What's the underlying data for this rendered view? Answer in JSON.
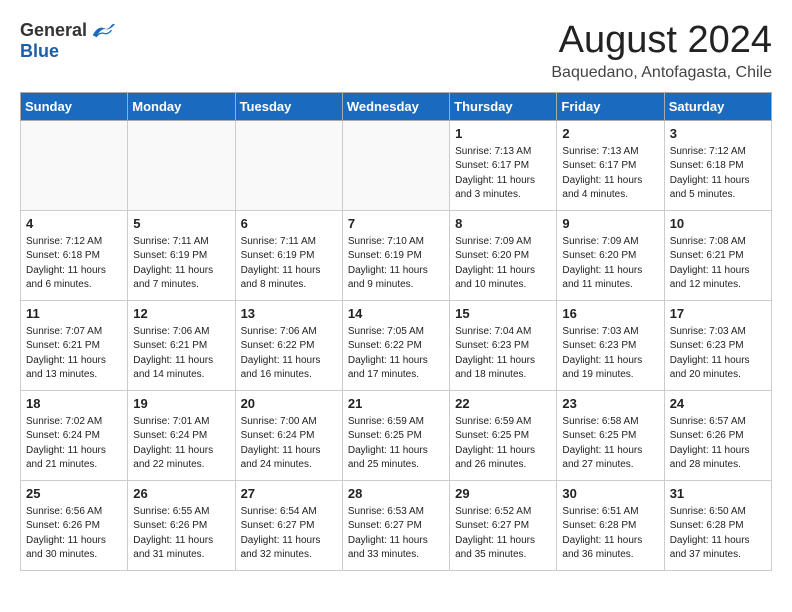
{
  "header": {
    "logo_general": "General",
    "logo_blue": "Blue",
    "month_year": "August 2024",
    "location": "Baquedano, Antofagasta, Chile"
  },
  "weekdays": [
    "Sunday",
    "Monday",
    "Tuesday",
    "Wednesday",
    "Thursday",
    "Friday",
    "Saturday"
  ],
  "weeks": [
    [
      {
        "day": "",
        "info": ""
      },
      {
        "day": "",
        "info": ""
      },
      {
        "day": "",
        "info": ""
      },
      {
        "day": "",
        "info": ""
      },
      {
        "day": "1",
        "info": "Sunrise: 7:13 AM\nSunset: 6:17 PM\nDaylight: 11 hours\nand 3 minutes."
      },
      {
        "day": "2",
        "info": "Sunrise: 7:13 AM\nSunset: 6:17 PM\nDaylight: 11 hours\nand 4 minutes."
      },
      {
        "day": "3",
        "info": "Sunrise: 7:12 AM\nSunset: 6:18 PM\nDaylight: 11 hours\nand 5 minutes."
      }
    ],
    [
      {
        "day": "4",
        "info": "Sunrise: 7:12 AM\nSunset: 6:18 PM\nDaylight: 11 hours\nand 6 minutes."
      },
      {
        "day": "5",
        "info": "Sunrise: 7:11 AM\nSunset: 6:19 PM\nDaylight: 11 hours\nand 7 minutes."
      },
      {
        "day": "6",
        "info": "Sunrise: 7:11 AM\nSunset: 6:19 PM\nDaylight: 11 hours\nand 8 minutes."
      },
      {
        "day": "7",
        "info": "Sunrise: 7:10 AM\nSunset: 6:19 PM\nDaylight: 11 hours\nand 9 minutes."
      },
      {
        "day": "8",
        "info": "Sunrise: 7:09 AM\nSunset: 6:20 PM\nDaylight: 11 hours\nand 10 minutes."
      },
      {
        "day": "9",
        "info": "Sunrise: 7:09 AM\nSunset: 6:20 PM\nDaylight: 11 hours\nand 11 minutes."
      },
      {
        "day": "10",
        "info": "Sunrise: 7:08 AM\nSunset: 6:21 PM\nDaylight: 11 hours\nand 12 minutes."
      }
    ],
    [
      {
        "day": "11",
        "info": "Sunrise: 7:07 AM\nSunset: 6:21 PM\nDaylight: 11 hours\nand 13 minutes."
      },
      {
        "day": "12",
        "info": "Sunrise: 7:06 AM\nSunset: 6:21 PM\nDaylight: 11 hours\nand 14 minutes."
      },
      {
        "day": "13",
        "info": "Sunrise: 7:06 AM\nSunset: 6:22 PM\nDaylight: 11 hours\nand 16 minutes."
      },
      {
        "day": "14",
        "info": "Sunrise: 7:05 AM\nSunset: 6:22 PM\nDaylight: 11 hours\nand 17 minutes."
      },
      {
        "day": "15",
        "info": "Sunrise: 7:04 AM\nSunset: 6:23 PM\nDaylight: 11 hours\nand 18 minutes."
      },
      {
        "day": "16",
        "info": "Sunrise: 7:03 AM\nSunset: 6:23 PM\nDaylight: 11 hours\nand 19 minutes."
      },
      {
        "day": "17",
        "info": "Sunrise: 7:03 AM\nSunset: 6:23 PM\nDaylight: 11 hours\nand 20 minutes."
      }
    ],
    [
      {
        "day": "18",
        "info": "Sunrise: 7:02 AM\nSunset: 6:24 PM\nDaylight: 11 hours\nand 21 minutes."
      },
      {
        "day": "19",
        "info": "Sunrise: 7:01 AM\nSunset: 6:24 PM\nDaylight: 11 hours\nand 22 minutes."
      },
      {
        "day": "20",
        "info": "Sunrise: 7:00 AM\nSunset: 6:24 PM\nDaylight: 11 hours\nand 24 minutes."
      },
      {
        "day": "21",
        "info": "Sunrise: 6:59 AM\nSunset: 6:25 PM\nDaylight: 11 hours\nand 25 minutes."
      },
      {
        "day": "22",
        "info": "Sunrise: 6:59 AM\nSunset: 6:25 PM\nDaylight: 11 hours\nand 26 minutes."
      },
      {
        "day": "23",
        "info": "Sunrise: 6:58 AM\nSunset: 6:25 PM\nDaylight: 11 hours\nand 27 minutes."
      },
      {
        "day": "24",
        "info": "Sunrise: 6:57 AM\nSunset: 6:26 PM\nDaylight: 11 hours\nand 28 minutes."
      }
    ],
    [
      {
        "day": "25",
        "info": "Sunrise: 6:56 AM\nSunset: 6:26 PM\nDaylight: 11 hours\nand 30 minutes."
      },
      {
        "day": "26",
        "info": "Sunrise: 6:55 AM\nSunset: 6:26 PM\nDaylight: 11 hours\nand 31 minutes."
      },
      {
        "day": "27",
        "info": "Sunrise: 6:54 AM\nSunset: 6:27 PM\nDaylight: 11 hours\nand 32 minutes."
      },
      {
        "day": "28",
        "info": "Sunrise: 6:53 AM\nSunset: 6:27 PM\nDaylight: 11 hours\nand 33 minutes."
      },
      {
        "day": "29",
        "info": "Sunrise: 6:52 AM\nSunset: 6:27 PM\nDaylight: 11 hours\nand 35 minutes."
      },
      {
        "day": "30",
        "info": "Sunrise: 6:51 AM\nSunset: 6:28 PM\nDaylight: 11 hours\nand 36 minutes."
      },
      {
        "day": "31",
        "info": "Sunrise: 6:50 AM\nSunset: 6:28 PM\nDaylight: 11 hours\nand 37 minutes."
      }
    ]
  ]
}
